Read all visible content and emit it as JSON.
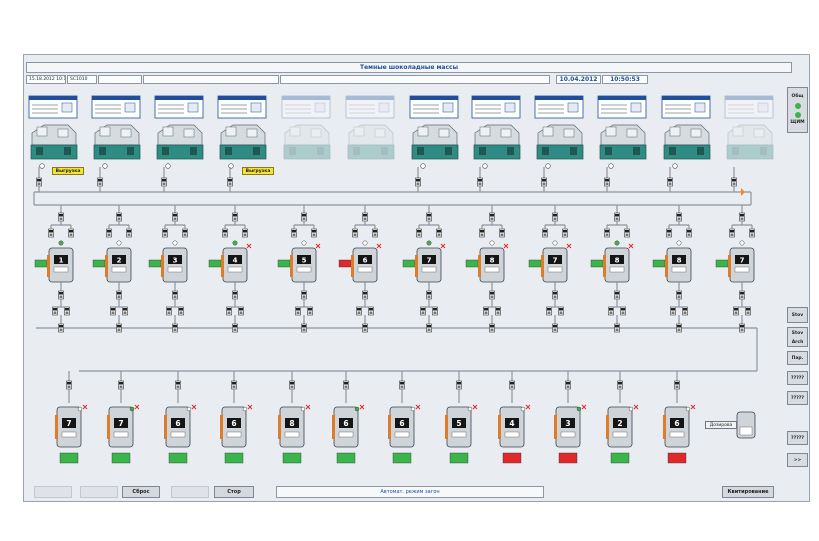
{
  "window": {
    "title": "Темные шоколадные массы"
  },
  "status_bar": {
    "field1": "15.18.2012 10:12:45",
    "field2": "SC1010",
    "date": "10.04.2012",
    "time": "10:50:53"
  },
  "colors": {
    "screen_bg": "#e9edf2",
    "machine_teal": "#2f8b83",
    "active_green": "#39b54a",
    "alarm_red": "#e0292b",
    "status_yellow": "#f5e23a",
    "title_blue": "#1f4f9a"
  },
  "refiners": {
    "count": 12,
    "inactive": [
      4,
      5,
      11
    ],
    "tags": [
      {
        "index": 0,
        "label": "Выгрузка"
      },
      {
        "index": 3,
        "label": "Выгрузка"
      }
    ]
  },
  "conches": {
    "row1_numbers": [
      "1",
      "2",
      "3",
      "4",
      "5",
      "6",
      "7",
      "8",
      "7",
      "8",
      "8",
      "7"
    ],
    "row2_numbers": [
      "7",
      "7",
      "6",
      "6",
      "8",
      "6",
      "6",
      "5",
      "4",
      "3",
      "2",
      "6"
    ],
    "alarm_row1": [
      5
    ],
    "alarm_row2": [
      8,
      9,
      11
    ]
  },
  "dosing": {
    "label": "Дозирова"
  },
  "sidebar": {
    "top_label": "Общ",
    "top_sub": "ЩИМ",
    "buttons": [
      "Stov",
      "Stov Arch",
      "Пар.",
      "?????",
      "?????",
      "?????",
      ">>"
    ]
  },
  "footer": {
    "btn_sbros": "Сброс",
    "btn_stop": "Стор",
    "message": "Автомат. режим загон",
    "btn_right": "Квитирование"
  }
}
